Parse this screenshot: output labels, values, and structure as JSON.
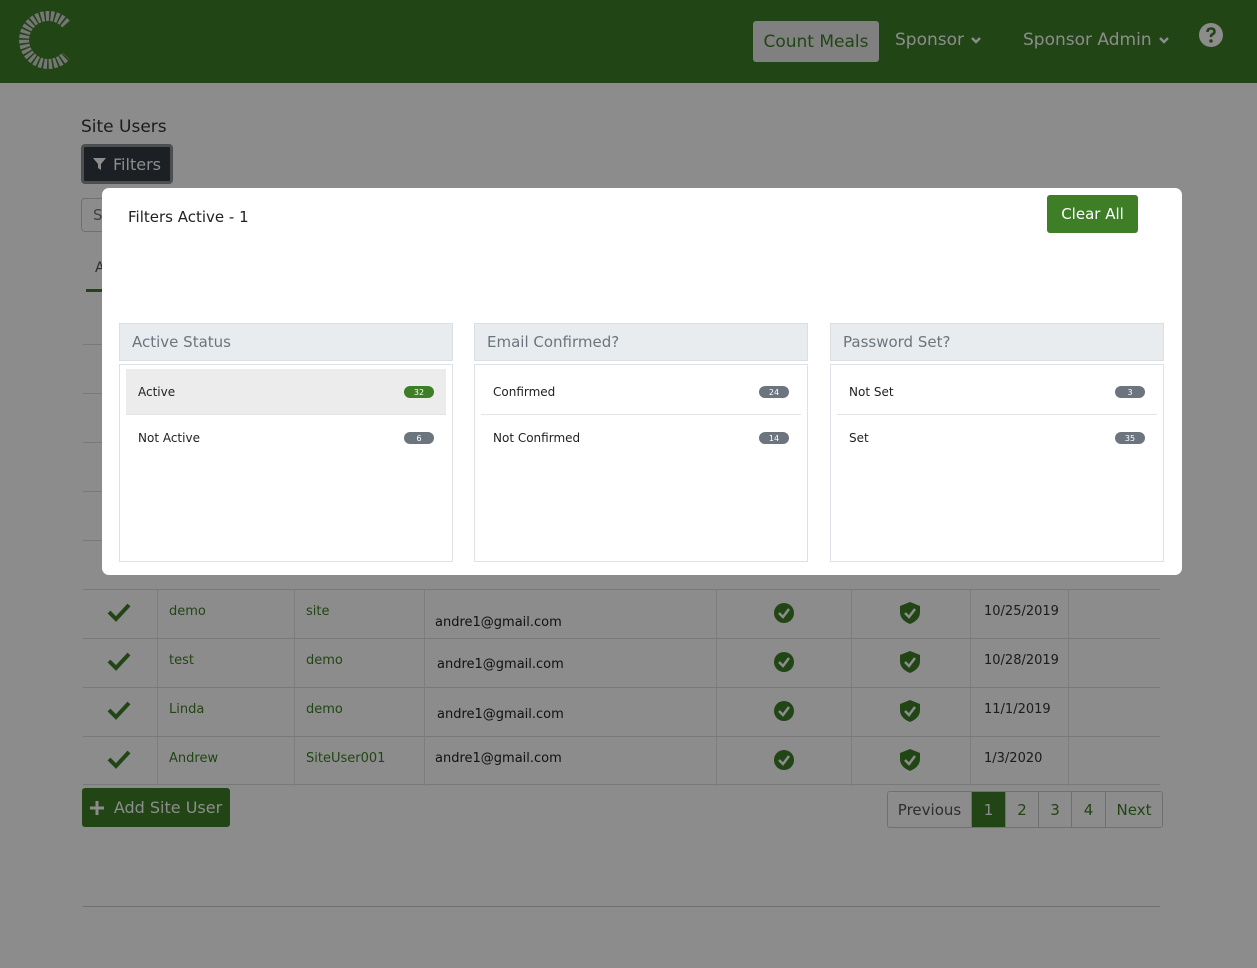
{
  "header": {
    "count_meals": "Count Meals",
    "sponsor": "Sponsor",
    "sponsor_admin": "Sponsor Admin"
  },
  "page": {
    "title": "Site Users",
    "filters_label": "Filters",
    "search_stub": "S",
    "tab_stub": "A"
  },
  "table": {
    "rows": [
      {
        "first": "demo",
        "last": "site",
        "email": "andre1@gmail.com",
        "date": "10/25/2019"
      },
      {
        "first": "test",
        "last": "demo",
        "email": "andre1@gmail.com",
        "date": "10/28/2019"
      },
      {
        "first": "Linda",
        "last": "demo",
        "email": "andre1@gmail.com",
        "date": "11/1/2019"
      },
      {
        "first": "Andrew",
        "last": "SiteUser001",
        "email": "andre1@gmail.com",
        "date": "1/3/2020"
      }
    ]
  },
  "add_button": "Add Site User",
  "pagination": {
    "previous": "Previous",
    "pages": [
      "1",
      "2",
      "3",
      "4"
    ],
    "active_page": "1",
    "next": "Next"
  },
  "modal": {
    "title": "Filters Active - 1",
    "clear_all": "Clear All",
    "panels": [
      {
        "heading": "Active Status",
        "items": [
          {
            "label": "Active",
            "count": "32",
            "selected": true
          },
          {
            "label": "Not Active",
            "count": "6",
            "selected": false
          }
        ]
      },
      {
        "heading": "Email Confirmed?",
        "items": [
          {
            "label": "Confirmed",
            "count": "24",
            "selected": false
          },
          {
            "label": "Not Confirmed",
            "count": "14",
            "selected": false
          }
        ]
      },
      {
        "heading": "Password Set?",
        "items": [
          {
            "label": "Not Set",
            "count": "3",
            "selected": false
          },
          {
            "label": "Set",
            "count": "35",
            "selected": false
          }
        ]
      }
    ]
  },
  "colors": {
    "brand_green": "#3e7e27",
    "badge_gray": "#6c757d",
    "filters_dark": "#343a40"
  },
  "icons": {
    "logo": "c-sunburst-logo",
    "help": "question-circle-icon",
    "filter": "funnel-icon",
    "active": "check-icon",
    "verified": "badge-check-icon",
    "password": "shield-check-icon",
    "add": "plus-icon"
  }
}
